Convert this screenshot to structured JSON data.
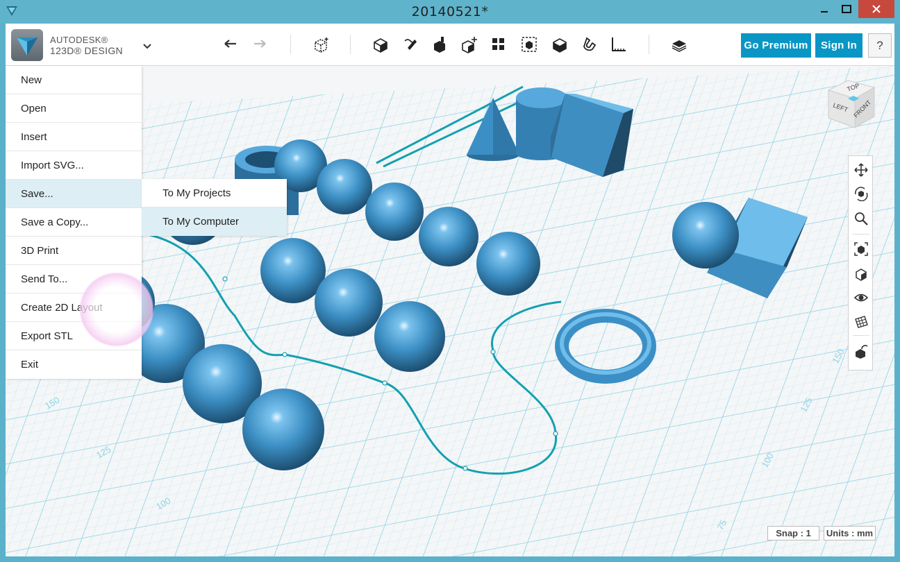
{
  "window": {
    "title": "20140521*"
  },
  "brand": {
    "line1": "AUTODESK®",
    "line2": "123D® DESIGN"
  },
  "toolbar": {
    "icons": [
      "undo-icon",
      "redo-icon",
      "primitives-icon",
      "sketch-icon",
      "construct-icon",
      "modify-icon",
      "pattern-icon",
      "grouping-icon",
      "combine-icon",
      "measure-icon",
      "snap-icon",
      "ruler-icon",
      "materials-icon"
    ],
    "go_premium": "Go Premium",
    "sign_in": "Sign In",
    "help": "?"
  },
  "file_menu": {
    "items": [
      {
        "label": "New"
      },
      {
        "label": "Open"
      },
      {
        "label": "Insert"
      },
      {
        "label": "Import SVG..."
      },
      {
        "label": "Save..."
      },
      {
        "label": "Save a Copy..."
      },
      {
        "label": "3D Print"
      },
      {
        "label": "Send To..."
      },
      {
        "label": "Create 2D Layout"
      },
      {
        "label": "Export STL"
      },
      {
        "label": "Exit"
      }
    ],
    "active_item": "Save...",
    "submenu": {
      "items": [
        {
          "label": "To My Projects"
        },
        {
          "label": "To My Computer"
        }
      ],
      "active_item": "To My Computer"
    }
  },
  "viewcube": {
    "top": "TOP",
    "left": "LEFT",
    "front": "FRONT"
  },
  "grid_labels": [
    "150",
    "125",
    "100",
    "150",
    "125",
    "100",
    "75"
  ],
  "status": {
    "snap": "Snap : 1",
    "units": "Units : mm"
  },
  "colors": {
    "accent": "#0996c4",
    "object": "#3c8fc4",
    "grid": "#8fd3e8",
    "curve": "#13a0b0"
  }
}
